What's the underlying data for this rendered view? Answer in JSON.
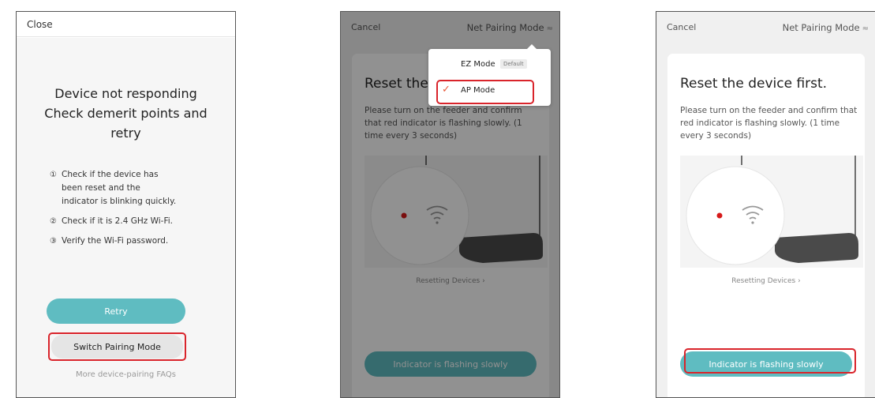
{
  "panel_failed": {
    "close_label": "Close",
    "title_lines": [
      "Device not responding",
      "Check demerit points and",
      "retry"
    ],
    "tips": [
      {
        "num": "①",
        "lines": [
          "Check if the device has",
          "been reset and the",
          "indicator is blinking quickly."
        ]
      },
      {
        "num": "②",
        "lines": [
          "Check if it is 2.4 GHz Wi-Fi."
        ]
      },
      {
        "num": "③",
        "lines": [
          "Verify the Wi-Fi password."
        ]
      }
    ],
    "retry_label": "Retry",
    "switch_label": "Switch Pairing Mode",
    "faq_label": "More device-pairing FAQs"
  },
  "header": {
    "cancel_label": "Cancel",
    "mode_label": "Net Pairing Mode",
    "mode_icon": "≈"
  },
  "card": {
    "title": "Reset the device first.",
    "title_partial": "Reset the",
    "description": "Please turn on the feeder and confirm that red indicator is flashing slowly. (1 time every 3 seconds)",
    "description_lines_partial": [
      "Please turn on the feeder and confirm",
      "that red indicator is flashing slowly. (1",
      "time every 3 seconds)"
    ],
    "reset_link": "Resetting Devices ›",
    "flash_button": "Indicator is flashing slowly"
  },
  "dropdown": {
    "items": [
      {
        "label": "EZ Mode",
        "badge": "Default",
        "selected": false
      },
      {
        "label": "AP Mode",
        "badge": "",
        "selected": true
      }
    ],
    "check_icon": "✓"
  },
  "colors": {
    "accent": "#5fbcc1",
    "highlight": "#d9242b",
    "check": "#e85a3c",
    "led": "#d61a1a"
  }
}
